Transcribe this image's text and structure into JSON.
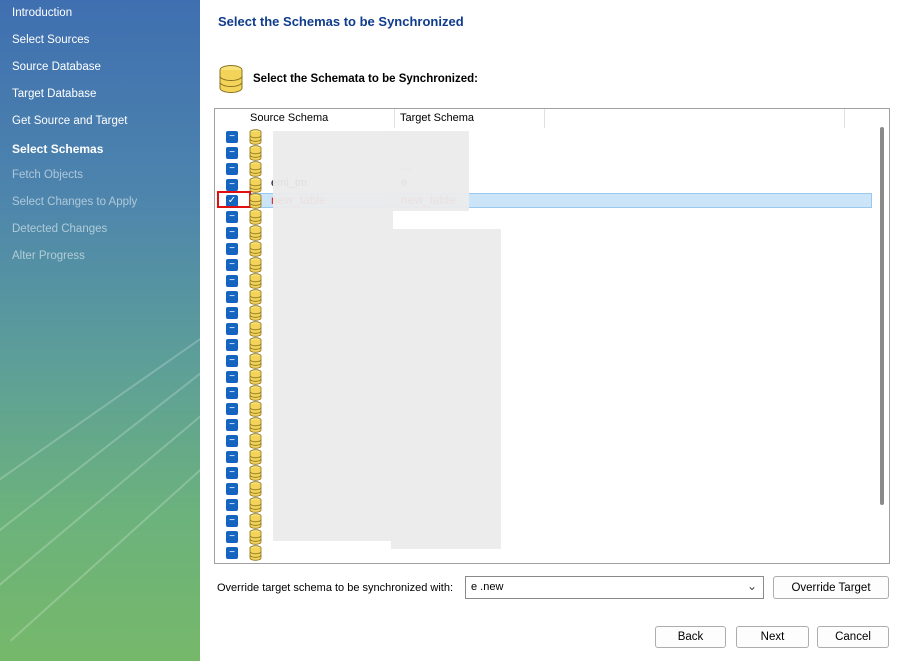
{
  "wizard": {
    "steps": [
      {
        "label": "Introduction",
        "state": "done"
      },
      {
        "label": "Select Sources",
        "state": "done"
      },
      {
        "label": "Source Database",
        "state": "done"
      },
      {
        "label": "Target Database",
        "state": "done"
      },
      {
        "label": "Get Source and Target",
        "state": "done"
      },
      {
        "label": "Select Schemas",
        "state": "current"
      },
      {
        "label": "Fetch Objects",
        "state": "pending"
      },
      {
        "label": "Select Changes to Apply",
        "state": "pending"
      },
      {
        "label": "Detected Changes",
        "state": "pending"
      },
      {
        "label": "Alter Progress",
        "state": "pending"
      }
    ]
  },
  "header": {
    "title": "Select the Schemas to be Synchronized",
    "section_title": "Select the Schemata to be Synchronized:"
  },
  "schema_list": {
    "columns": [
      "Source Schema",
      "Target Schema"
    ],
    "rows": [
      {
        "source": "",
        "target": "",
        "checked": false
      },
      {
        "source": "",
        "target": "",
        "checked": false
      },
      {
        "source": "",
        "target": "…",
        "checked": false
      },
      {
        "source": "emi_tm",
        "target": "e",
        "checked": false
      },
      {
        "source": "new_table",
        "target": "new_table",
        "checked": true,
        "selected": true
      },
      {
        "source": "",
        "target": "",
        "checked": false
      },
      {
        "source": "",
        "target": "",
        "checked": false
      },
      {
        "source": "",
        "target": "",
        "checked": false
      },
      {
        "source": "",
        "target": "",
        "checked": false
      },
      {
        "source": "",
        "target": "",
        "checked": false
      },
      {
        "source": "",
        "target": "",
        "checked": false
      },
      {
        "source": "",
        "target": "",
        "checked": false
      },
      {
        "source": "",
        "target": "",
        "checked": false
      },
      {
        "source": "",
        "target": "",
        "checked": false
      },
      {
        "source": "",
        "target": "",
        "checked": false
      },
      {
        "source": "",
        "target": "",
        "checked": false
      },
      {
        "source": "",
        "target": "",
        "checked": false
      },
      {
        "source": "",
        "target": "",
        "checked": false
      },
      {
        "source": "",
        "target": "",
        "checked": false
      },
      {
        "source": "",
        "target": "",
        "checked": false
      },
      {
        "source": "",
        "target": "",
        "checked": false
      },
      {
        "source": "",
        "target": "",
        "checked": false
      },
      {
        "source": "",
        "target": "",
        "checked": false
      },
      {
        "source": "",
        "target": "",
        "checked": false
      },
      {
        "source": "",
        "target": "",
        "checked": false
      },
      {
        "source": "",
        "target": "",
        "checked": false
      },
      {
        "source": "",
        "target": "",
        "checked": false
      }
    ]
  },
  "override": {
    "label": "Override target schema to be synchronized with:",
    "value": "e        .new",
    "button": "Override Target"
  },
  "footer": {
    "back": "Back",
    "next": "Next",
    "cancel": "Cancel"
  },
  "colors": {
    "accent": "#0f3c8c",
    "toggle": "#1565c0",
    "selection": "#cce4f7",
    "annotation": "#e01010"
  }
}
